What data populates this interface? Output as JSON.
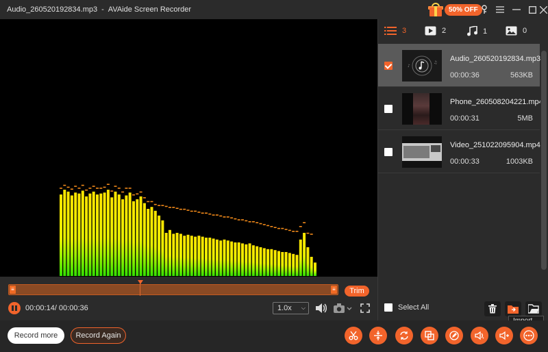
{
  "window": {
    "filename": "Audio_260520192834.mp3",
    "separator": "-",
    "app_name": "AVAide Screen Recorder",
    "promo_badge": "50% OFF"
  },
  "tabs": [
    {
      "icon": "list-icon",
      "count": "3"
    },
    {
      "icon": "video-icon",
      "count": "2"
    },
    {
      "icon": "music-icon",
      "count": "1"
    },
    {
      "icon": "image-icon",
      "count": "0"
    }
  ],
  "files": [
    {
      "name": "Audio_260520192834.mp3",
      "duration": "00:00:36",
      "size": "563KB",
      "checked": true
    },
    {
      "name": "Phone_260508204221.mp4",
      "duration": "00:00:31",
      "size": "5MB",
      "checked": false
    },
    {
      "name": "Video_251022095904.mp4",
      "duration": "00:00:33",
      "size": "1003KB",
      "checked": false
    }
  ],
  "player": {
    "time": "00:00:14/ 00:00:36",
    "speed": "1.0x",
    "trim_label": "Trim",
    "progress": 0.39
  },
  "panel_footer": {
    "select_all": "Select All",
    "tooltip": "Import"
  },
  "bottom": {
    "record_more": "Record more",
    "record_again": "Record Again"
  },
  "colors": {
    "accent": "#f2642b",
    "panel_bg": "#2b2b2b",
    "selected_row": "#5a5a5a"
  },
  "spectrum": {
    "bars": [
      0.85,
      0.9,
      0.88,
      0.84,
      0.87,
      0.86,
      0.89,
      0.83,
      0.86,
      0.88,
      0.85,
      0.86,
      0.87,
      0.9,
      0.82,
      0.88,
      0.85,
      0.8,
      0.84,
      0.87,
      0.78,
      0.8,
      0.83,
      0.76,
      0.7,
      0.72,
      0.68,
      0.63,
      0.58,
      0.45,
      0.48,
      0.44,
      0.45,
      0.44,
      0.42,
      0.43,
      0.42,
      0.41,
      0.42,
      0.41,
      0.4,
      0.4,
      0.39,
      0.38,
      0.37,
      0.38,
      0.37,
      0.36,
      0.35,
      0.35,
      0.34,
      0.33,
      0.34,
      0.32,
      0.31,
      0.3,
      0.29,
      0.28,
      0.28,
      0.27,
      0.26,
      0.25,
      0.25,
      0.24,
      0.23,
      0.22,
      0.38,
      0.45,
      0.3,
      0.2,
      0.14
    ],
    "peaks": [
      0.9,
      0.93,
      0.91,
      0.89,
      0.92,
      0.9,
      0.93,
      0.88,
      0.9,
      0.92,
      0.9,
      0.9,
      0.91,
      0.94,
      0.87,
      0.92,
      0.9,
      0.86,
      0.9,
      0.9,
      0.83,
      0.84,
      0.86,
      0.8,
      0.76,
      0.76,
      0.73,
      0.72,
      0.72,
      0.71,
      0.7,
      0.7,
      0.69,
      0.68,
      0.68,
      0.67,
      0.66,
      0.66,
      0.65,
      0.64,
      0.64,
      0.63,
      0.62,
      0.62,
      0.61,
      0.6,
      0.6,
      0.59,
      0.58,
      0.57,
      0.57,
      0.56,
      0.55,
      0.55,
      0.54,
      0.53,
      0.52,
      0.51,
      0.5,
      0.49,
      0.48,
      0.48,
      0.47,
      0.46,
      0.45,
      0.45,
      0.5,
      0.54,
      0.43,
      0.42,
      0.0
    ]
  }
}
